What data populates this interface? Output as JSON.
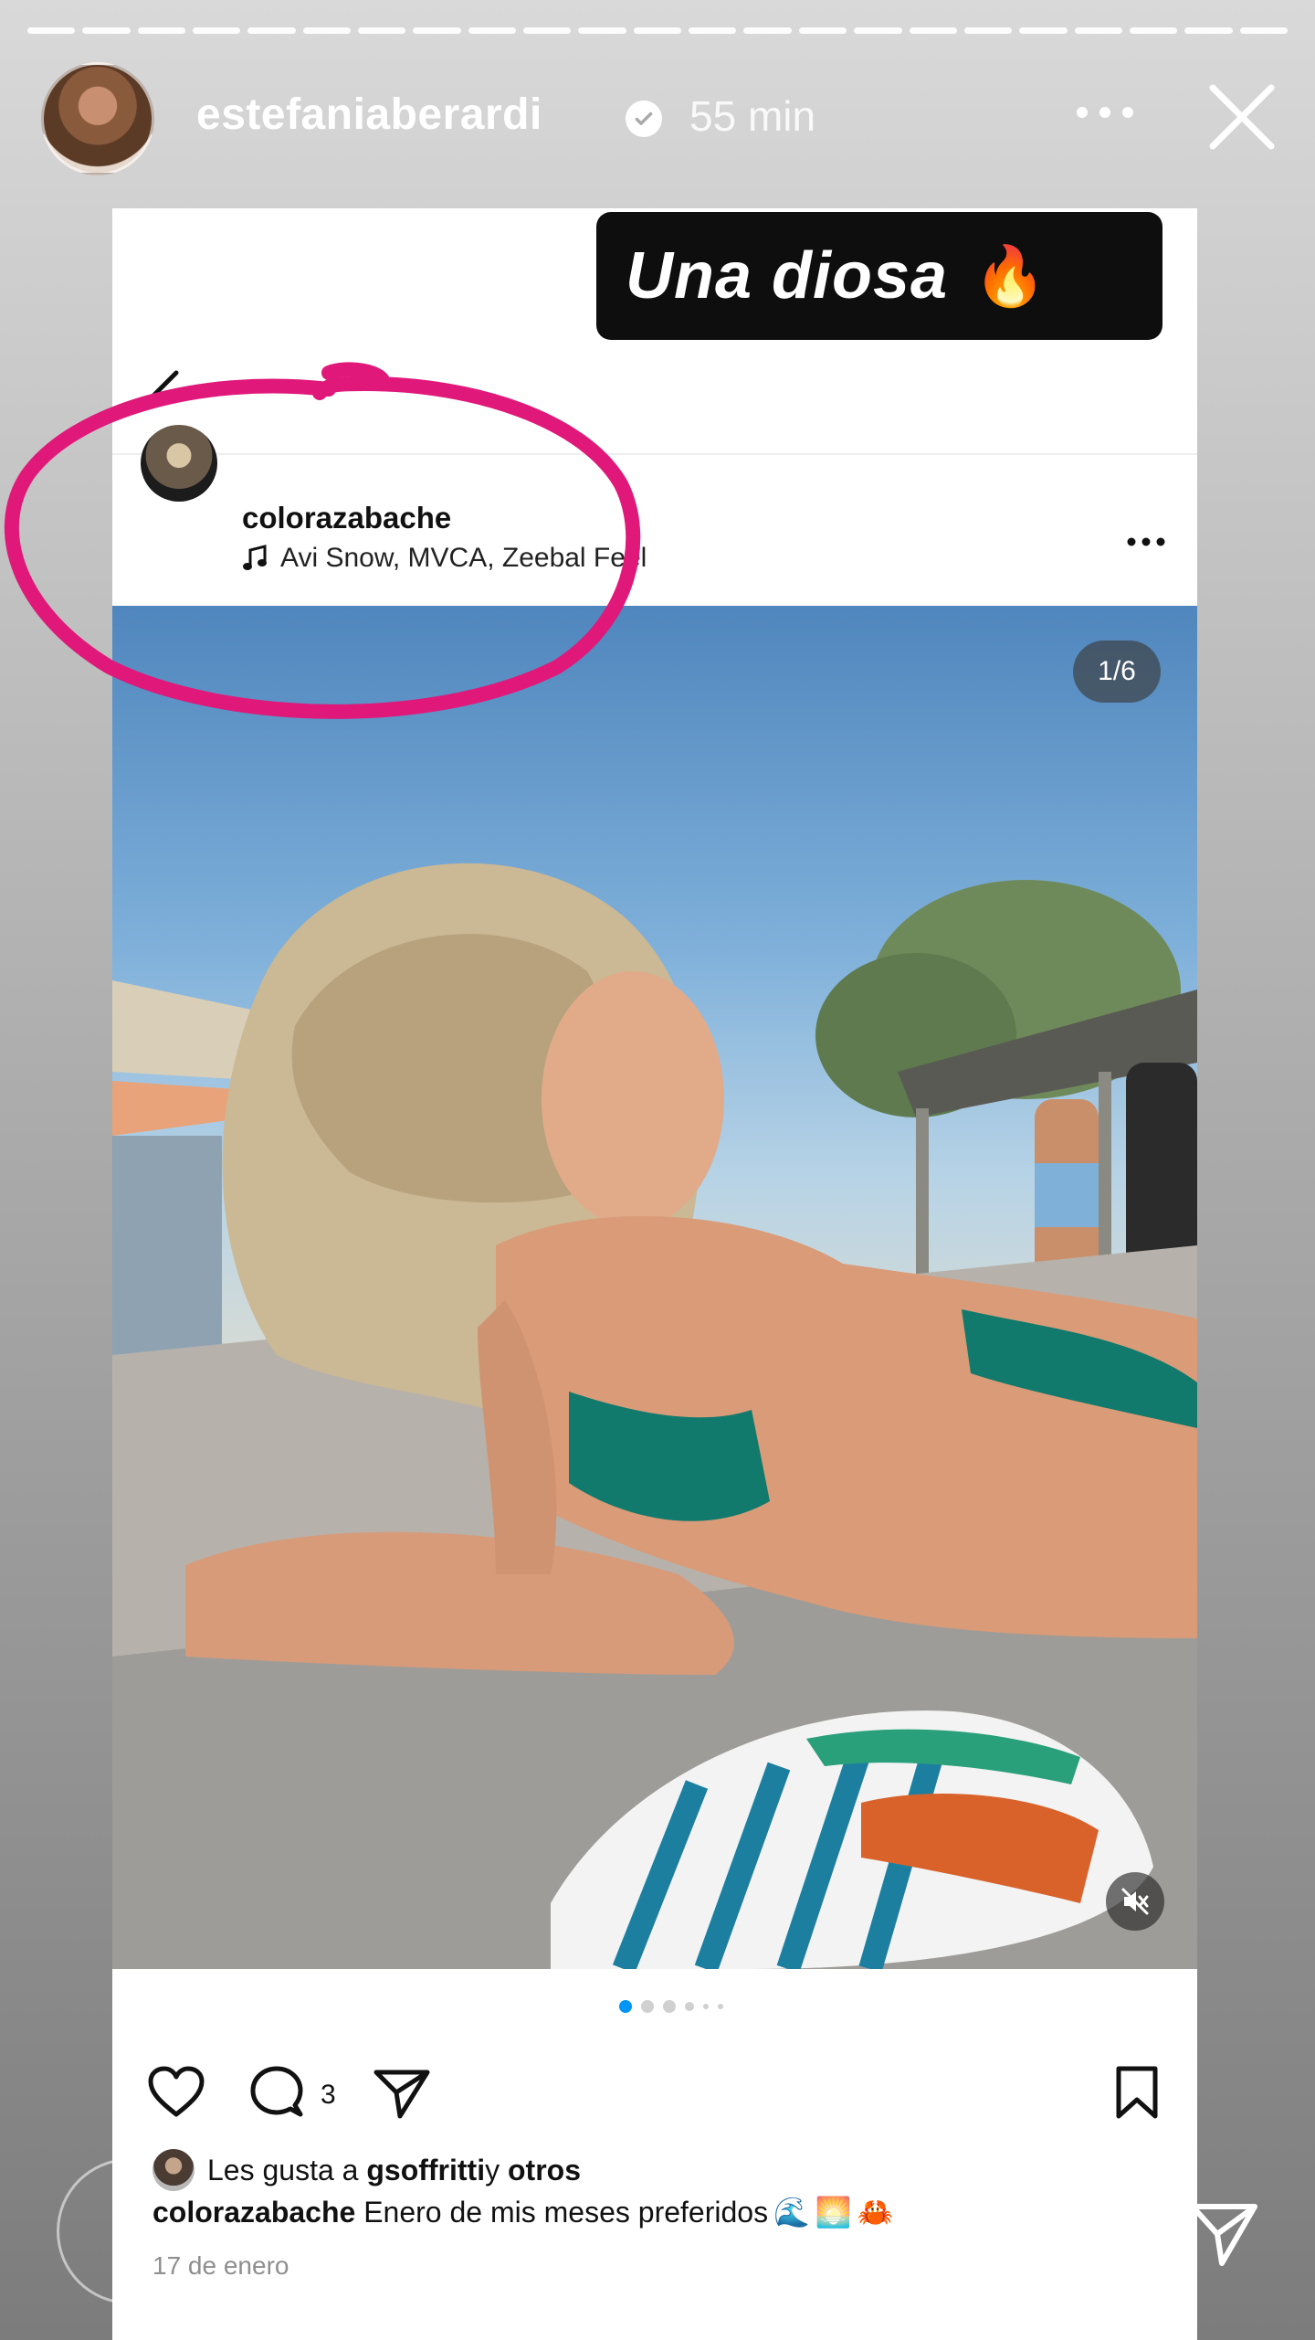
{
  "story": {
    "progress_segments": 23,
    "progress_current": 23,
    "username": "estefaniaberardi",
    "time_ago": "55 min",
    "sticker_text": "Una diosa",
    "sticker_emoji": "🔥",
    "icons": {
      "verified": "verified-badge-icon",
      "more": "more-dots-icon",
      "close": "close-icon",
      "send": "send-icon"
    }
  },
  "post": {
    "username": "colorazabache",
    "music": "Avi Snow, MVCA, Zeebal Feel",
    "page_indicator": "1/6",
    "carousel_count": 6,
    "carousel_active": 0,
    "comment_count": "3",
    "likes_prefix": "Les gusta a ",
    "likes_user": "gsoffritti",
    "likes_middle": " y ",
    "likes_suffix": "otros",
    "caption_user": "colorazabache",
    "caption_text": " Enero de mis meses preferidos",
    "caption_emojis": "🌊🌅🦀",
    "date": "17 de enero"
  },
  "colors": {
    "accent_blue": "#0095f6",
    "annotation_pink": "#e0187a",
    "sticker_bg": "#0e0e0e"
  }
}
